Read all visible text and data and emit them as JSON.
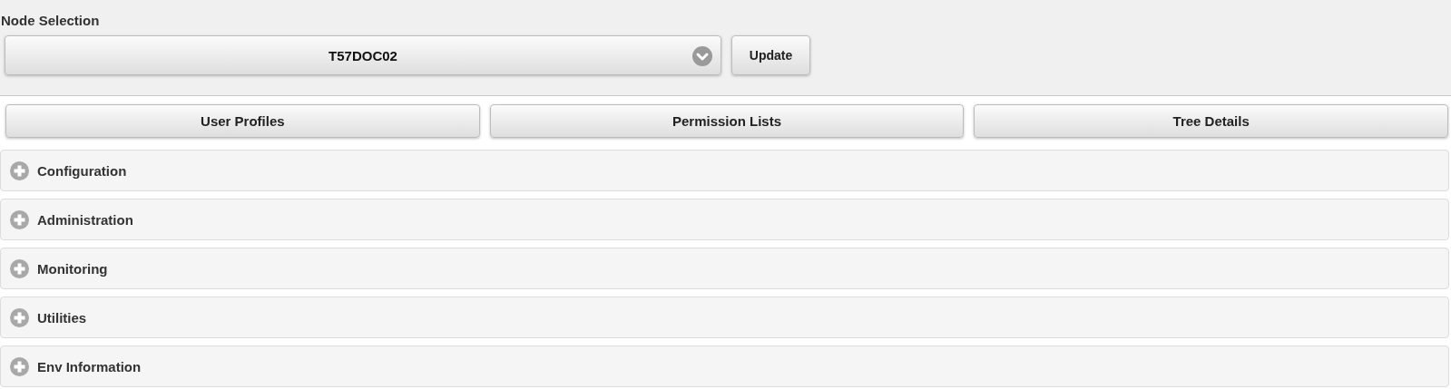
{
  "node_selection": {
    "label": "Node Selection",
    "value": "T57DOC02",
    "update_button": "Update"
  },
  "nav_buttons": [
    "User Profiles",
    "Permission Lists",
    "Tree Details"
  ],
  "sections": [
    {
      "title": "Configuration",
      "expanded": false
    },
    {
      "title": "Administration",
      "expanded": false
    },
    {
      "title": "Monitoring",
      "expanded": false
    },
    {
      "title": "Utilities",
      "expanded": false
    },
    {
      "title": "Env Information",
      "expanded": false
    }
  ]
}
